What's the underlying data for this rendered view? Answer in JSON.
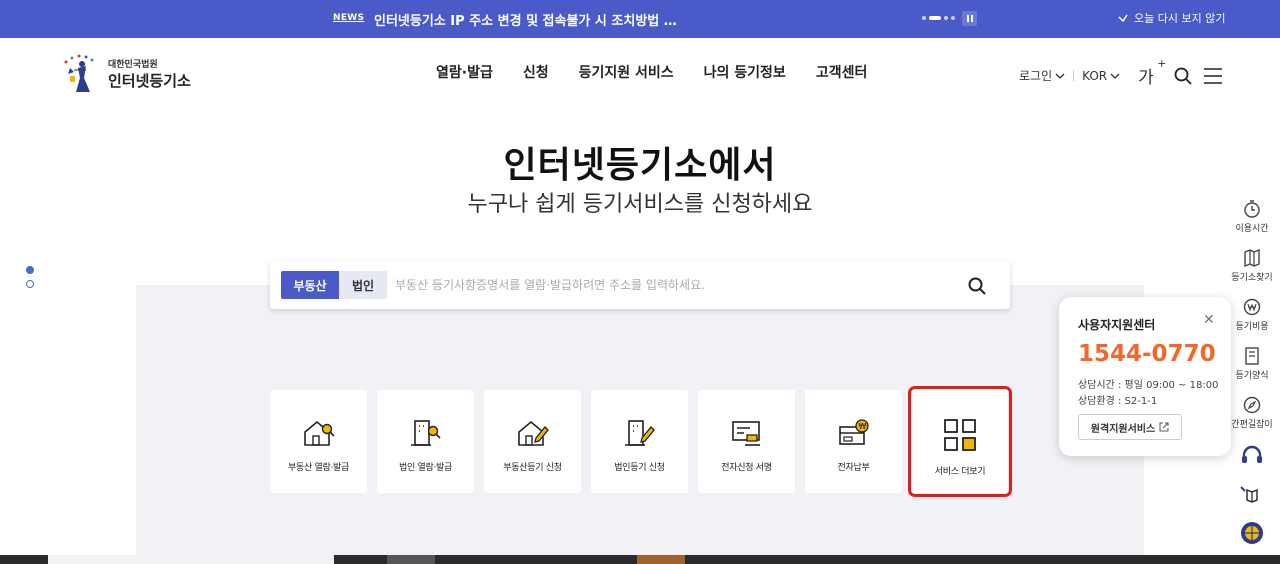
{
  "topbar": {
    "news_label": "NEWS",
    "news_text": "인터넷등기소 IP 주소 변경 및 접속불가 시 조치방법 …",
    "no_show_label": "오늘 다시 보지 않기"
  },
  "logo": {
    "small": "대한민국법원",
    "big": "인터넷등기소"
  },
  "nav": [
    "열람·발급",
    "신청",
    "등기지원 서비스",
    "나의 등기정보",
    "고객센터"
  ],
  "util": {
    "login": "로그인",
    "lang": "KOR",
    "font": "가"
  },
  "hero": {
    "title": "인터넷등기소에서",
    "subtitle": "누구나 쉽게 등기서비스를 신청하세요"
  },
  "search": {
    "tab_realestate": "부동산",
    "tab_corp": "법인",
    "placeholder": "부동산 등기사항증명서를 열람·발급하려면 주소를 입력하세요."
  },
  "cards": [
    {
      "label": "부동산 열람·발급",
      "icon": "house-search-icon"
    },
    {
      "label": "법인 열람·발급",
      "icon": "building-search-icon"
    },
    {
      "label": "부동산등기 신청",
      "icon": "house-edit-icon"
    },
    {
      "label": "법인등기 신청",
      "icon": "building-edit-icon"
    },
    {
      "label": "전자신청 서명",
      "icon": "signature-icon"
    },
    {
      "label": "전자납부",
      "icon": "payment-icon"
    },
    {
      "label": "서비스 더보기",
      "icon": "grid-icon"
    }
  ],
  "rightbar": [
    {
      "label": "이용시간",
      "icon": "clock-icon"
    },
    {
      "label": "등기소찾기",
      "icon": "map-icon"
    },
    {
      "label": "등기비용",
      "icon": "won-icon"
    },
    {
      "label": "등기양식",
      "icon": "document-icon"
    },
    {
      "label": "간편길잡이",
      "icon": "compass-icon"
    }
  ],
  "popup": {
    "title": "사용자지원센터",
    "phone": "1544-0770",
    "hours": "상담시간 : 평일 09:00 ~ 18:00",
    "env": "상담환경 : S2-1-1",
    "remote_btn": "원격지원서비스"
  },
  "colors": {
    "primary": "#4a5ac9",
    "phone": "#f2672a",
    "highlight": "#e31b1b"
  }
}
